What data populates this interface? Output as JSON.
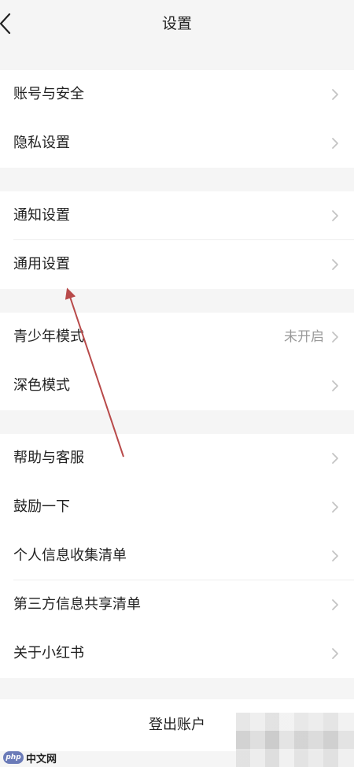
{
  "header": {
    "title": "设置"
  },
  "groups": [
    {
      "items": [
        {
          "label": "账号与安全"
        },
        {
          "label": "隐私设置"
        }
      ]
    },
    {
      "items": [
        {
          "label": "通知设置"
        },
        {
          "label": "通用设置"
        }
      ]
    },
    {
      "items": [
        {
          "label": "青少年模式",
          "value": "未开启"
        },
        {
          "label": "深色模式"
        }
      ]
    },
    {
      "items": [
        {
          "label": "帮助与客服"
        },
        {
          "label": "鼓励一下"
        },
        {
          "label": "个人信息收集清单"
        },
        {
          "label": "第三方信息共享清单"
        },
        {
          "label": "关于小红书"
        }
      ]
    }
  ],
  "logout": {
    "label": "登出账户"
  },
  "watermark": {
    "logo": "php",
    "text": "中文网"
  },
  "colors": {
    "background": "#f5f5f5",
    "card": "#ffffff",
    "text": "#222222",
    "secondary_text": "#999999",
    "chevron": "#c4c4c4",
    "annotation_arrow": "#b84a4a"
  },
  "icons": {
    "back": "chevron-left-icon",
    "row_arrow": "chevron-right-icon"
  }
}
